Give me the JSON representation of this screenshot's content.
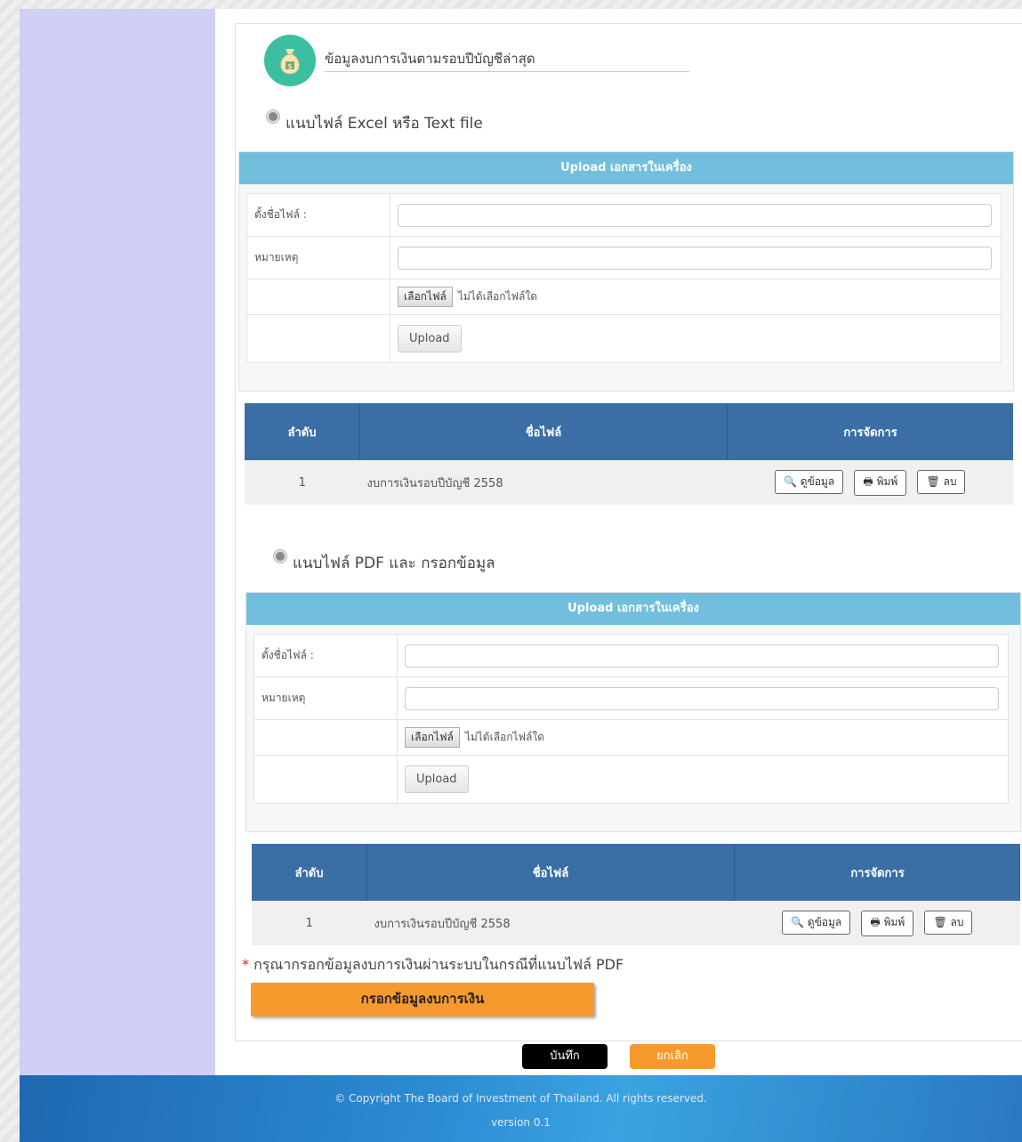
{
  "header": {
    "title": "ข้อมูลงบการเงินตามรอบปีบัญชีล่าสุด"
  },
  "section_excel": {
    "radio_label": "แนบไฟล์ Excel หรือ Text file",
    "upload_title": "Upload เอกสารในเครื่อง",
    "filename_label": "ตั้งชื่อไฟล์ :",
    "note_label": "หมายเหตุ",
    "choose_file": "เลือกไฟล์",
    "no_file": "ไม่ได้เลือกไฟล์ใด",
    "upload_button": "Upload",
    "table": {
      "col_no": "ลำดับ",
      "col_name": "ชื่อไฟล์",
      "col_actions": "การจัดการ",
      "rows": [
        {
          "no": "1",
          "name": "งบการเงินรอบปีบัญชี 2558"
        }
      ]
    }
  },
  "section_pdf": {
    "radio_label": "แนบไฟล์ PDF และ กรอกข้อมูล",
    "upload_title": "Upload เอกสารในเครื่อง",
    "filename_label": "ตั้งชื่อไฟล์ :",
    "note_label": "หมายเหตุ",
    "choose_file": "เลือกไฟล์",
    "no_file": "ไม่ได้เลือกไฟล์ใด",
    "upload_button": "Upload",
    "table": {
      "col_no": "ลำดับ",
      "col_name": "ชื่อไฟล์",
      "col_actions": "การจัดการ",
      "rows": [
        {
          "no": "1",
          "name": "งบการเงินรอบปีบัญชี 2558"
        }
      ]
    }
  },
  "actions": {
    "view": "ดูข้อมูล",
    "print": "พิมพ์",
    "delete": "ลบ"
  },
  "note": {
    "star": "*",
    "text": "กรุณากรอกข้อมูลงบการเงินผ่านระบบในกรณีที่แนบไฟล์ PDF",
    "fill_button": "กรอกข้อมูลงบการเงิน"
  },
  "buttons": {
    "save": "บันทึก",
    "cancel": "ยกเลิก"
  },
  "footer": {
    "copyright": "© Copyright The Board of Investment of Thailand. All rights reserved.",
    "version": "version 0.1"
  },
  "colors": {
    "sidebar": "#cfcff7",
    "upload_header": "#71bfdc",
    "table_header": "#3a6ea5",
    "accent_orange": "#f79a2e"
  }
}
